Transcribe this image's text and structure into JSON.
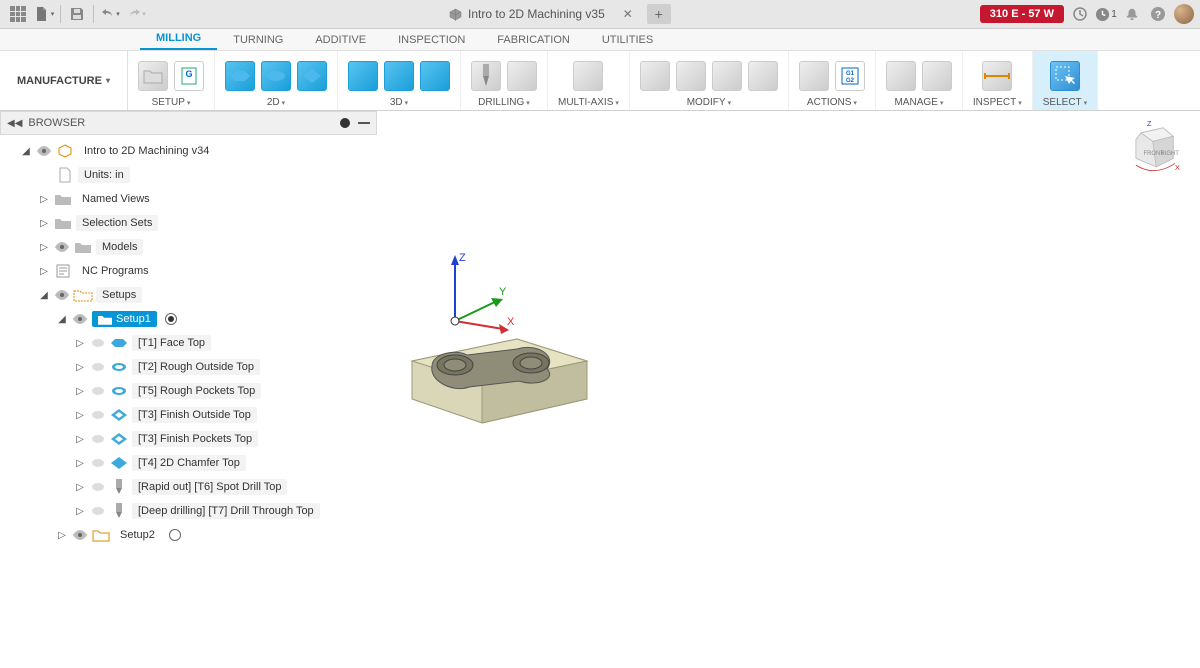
{
  "title_bar": {
    "doc_title": "Intro to 2D Machining v35",
    "job_status": "310 E - 57 W",
    "clock_badge": "1"
  },
  "tabs": {
    "items": [
      "MILLING",
      "TURNING",
      "ADDITIVE",
      "INSPECTION",
      "FABRICATION",
      "UTILITIES"
    ],
    "active_index": 0
  },
  "workspace": {
    "label": "MANUFACTURE"
  },
  "ribbon": {
    "groups": [
      {
        "label": "SETUP"
      },
      {
        "label": "2D"
      },
      {
        "label": "3D"
      },
      {
        "label": "DRILLING"
      },
      {
        "label": "MULTI-AXIS"
      },
      {
        "label": "MODIFY"
      },
      {
        "label": "ACTIONS"
      },
      {
        "label": "MANAGE"
      },
      {
        "label": "INSPECT"
      },
      {
        "label": "SELECT"
      }
    ]
  },
  "browser": {
    "title": "BROWSER",
    "root": "Intro to 2D Machining v34",
    "units": "Units: in",
    "folders": {
      "named_views": "Named Views",
      "selection_sets": "Selection Sets",
      "models": "Models",
      "nc_programs": "NC Programs",
      "setups": "Setups"
    },
    "setup1": {
      "label": "Setup1",
      "ops": [
        "[T1] Face Top",
        "[T2] Rough Outside Top",
        "[T5] Rough Pockets Top",
        "[T3] Finish Outside Top",
        "[T3] Finish Pockets Top",
        "[T4] 2D Chamfer Top",
        "[Rapid out] [T6] Spot Drill Top",
        "[Deep drilling] [T7] Drill Through Top"
      ]
    },
    "setup2": {
      "label": "Setup2"
    }
  },
  "viewcube": {
    "front": "FRONT",
    "right": "RIGHT",
    "z": "Z",
    "x": "X"
  },
  "axis": {
    "x": "X",
    "y": "Y",
    "z": "Z"
  }
}
